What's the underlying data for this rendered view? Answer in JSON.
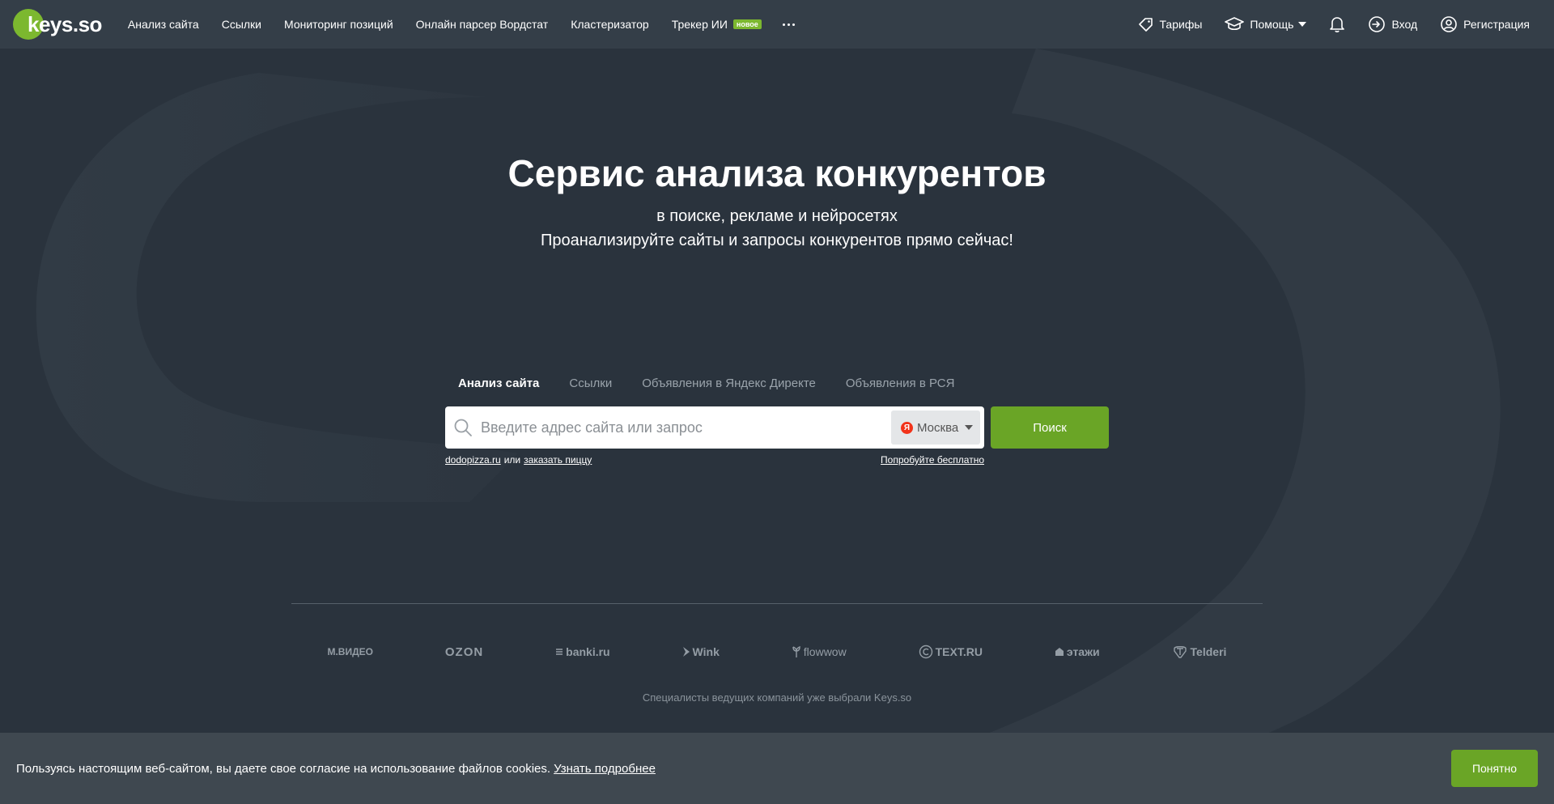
{
  "logo": {
    "text": "keys.so"
  },
  "nav": {
    "items": [
      {
        "label": "Анализ сайта"
      },
      {
        "label": "Ссылки"
      },
      {
        "label": "Мониторинг позиций"
      },
      {
        "label": "Онлайн парсер Вордстат"
      },
      {
        "label": "Кластеризатор"
      },
      {
        "label": "Трекер ИИ",
        "badge": "новое"
      }
    ],
    "right": {
      "tariffs": "Тарифы",
      "help": "Помощь",
      "login": "Вход",
      "register": "Регистрация"
    }
  },
  "hero": {
    "title": "Сервис анализа конкурентов",
    "subtitle1": "в поиске, рекламе и нейросетях",
    "subtitle2": "Проанализируйте сайты и запросы конкурентов прямо сейчас!"
  },
  "search": {
    "tabs": [
      {
        "label": "Анализ сайта",
        "active": true
      },
      {
        "label": "Ссылки"
      },
      {
        "label": "Объявления в Яндекс Директе"
      },
      {
        "label": "Объявления в РСЯ"
      }
    ],
    "placeholder": "Введите адрес сайта или запрос",
    "region": "Москва",
    "region_icon_letter": "Я",
    "button": "Поиск",
    "hint_example1": "dodopizza.ru",
    "hint_or": "или",
    "hint_example2": "заказать пиццу",
    "try_free": "Попробуйте бесплатно"
  },
  "clients": {
    "logos": [
      "М.ВИДЕО",
      "OZON",
      "banki.ru",
      "Wink",
      "flowwow",
      "TEXT.RU",
      "этажи",
      "Telderi"
    ],
    "caption": "Специалисты ведущих компаний уже выбрали Keys.so"
  },
  "cookie": {
    "text": "Пользуясь настоящим веб-сайтом, вы даете свое согласие на использование файлов cookies.",
    "link": "Узнать подробнее",
    "button": "Понятно"
  },
  "colors": {
    "background": "#2a333d",
    "topbar": "#343e48",
    "accent": "#6aa526",
    "cookie_bar": "#3f4850"
  },
  "icons": {
    "tariffs": "tag-icon",
    "help": "graduation-cap-icon",
    "notifications": "bell-icon",
    "login": "login-icon",
    "register": "user-icon",
    "search": "search-icon",
    "more": "more-dots-icon"
  }
}
